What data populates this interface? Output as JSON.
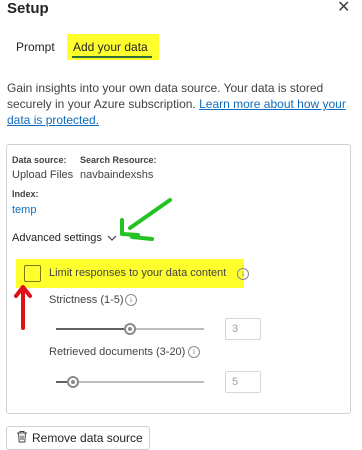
{
  "header": {
    "title": "Setup"
  },
  "tabs": [
    {
      "label": "Prompt"
    },
    {
      "label": "Add your data"
    }
  ],
  "description": {
    "text": "Gain insights into your own data source. Your data is stored securely in your Azure subscription. ",
    "link": "Learn more about how your data is protected."
  },
  "datasource": {
    "source_label": "Data source:",
    "source_value": "Upload Files",
    "resource_label": "Search Resource:",
    "resource_value": "navbaindexshs",
    "index_label": "Index:",
    "index_value": "temp"
  },
  "advanced": {
    "label": "Advanced settings",
    "limit_label": "Limit responses to your data content",
    "limit_checked": false,
    "strictness": {
      "label": "Strictness (1-5)",
      "value": "3",
      "min": 1,
      "max": 5
    },
    "retrieved": {
      "label": "Retrieved documents (3-20)",
      "value": "5",
      "min": 3,
      "max": 20
    }
  },
  "actions": {
    "remove_label": "Remove data source"
  },
  "colors": {
    "highlight": "#ffff2e",
    "link": "#0f6cbd",
    "arrow_green": "#22c322",
    "arrow_red": "#e0101a"
  },
  "icons": {
    "close": "close-icon",
    "chevron": "chevron-down-icon",
    "info": "info-icon",
    "trash": "trash-icon"
  }
}
